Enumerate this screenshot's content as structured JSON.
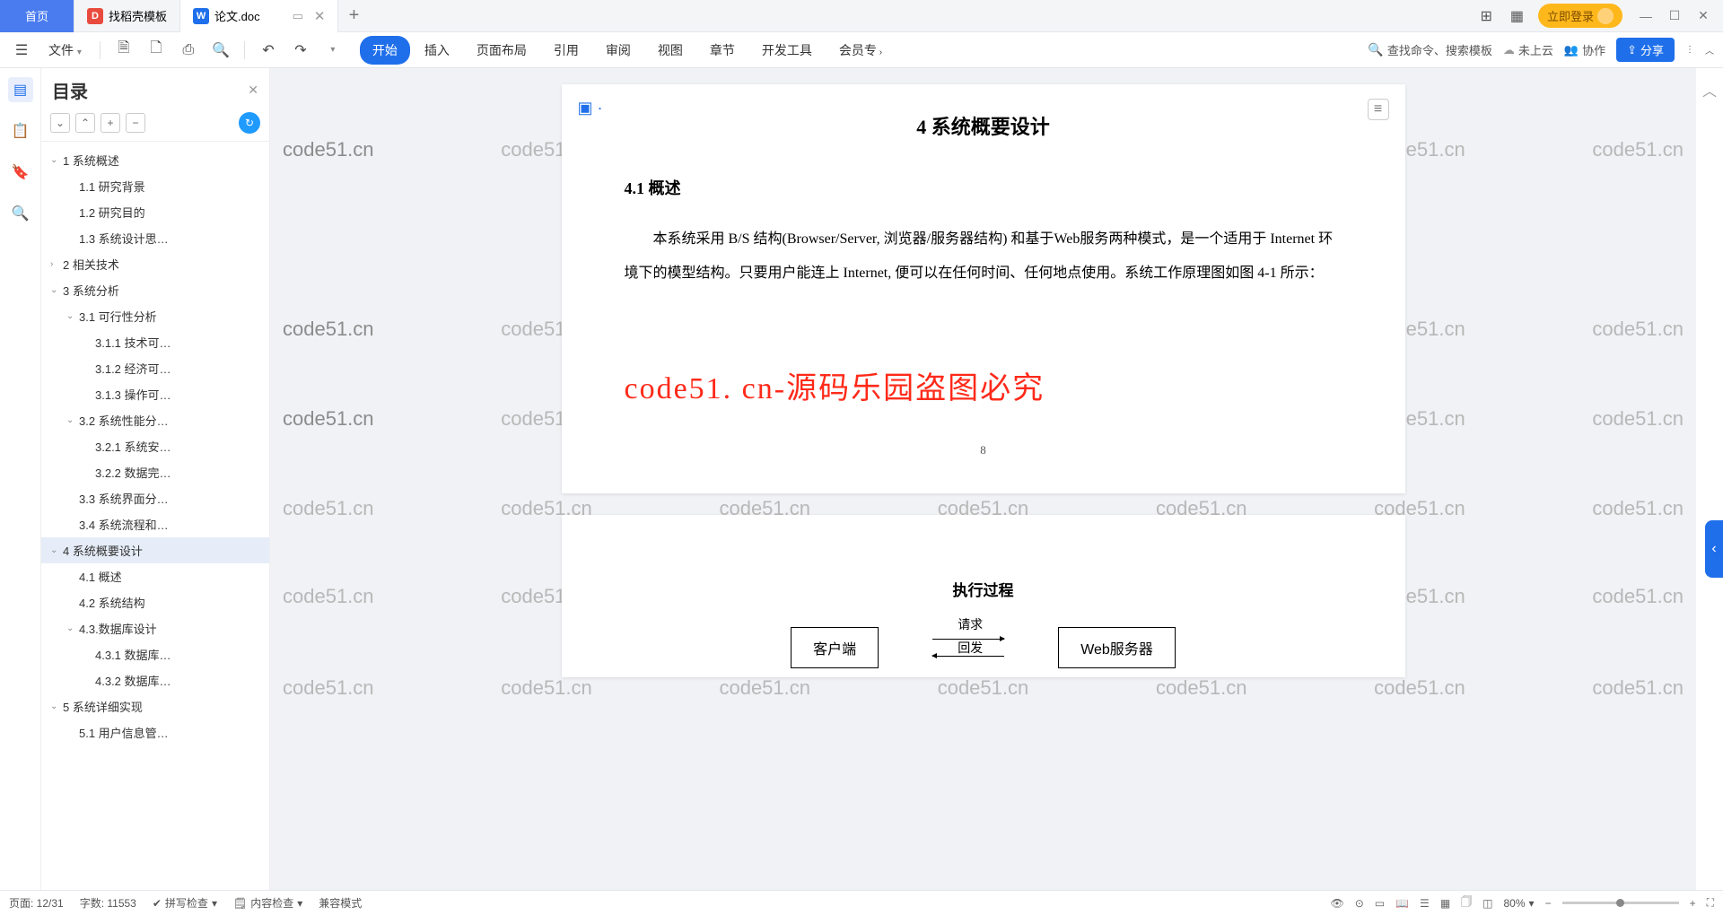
{
  "tabs": {
    "home": "首页",
    "t1": "找稻壳模板",
    "t2": "论文.doc",
    "add": "+"
  },
  "titlebar": {
    "login": "立即登录"
  },
  "qat": {
    "file": "文件"
  },
  "ribbon": {
    "tabs": [
      "开始",
      "插入",
      "页面布局",
      "引用",
      "审阅",
      "视图",
      "章节",
      "开发工具",
      "会员专"
    ],
    "search": "查找命令、搜索模板",
    "cloud": "未上云",
    "collab": "协作",
    "share": "分享"
  },
  "outline": {
    "title": "目录",
    "items": [
      {
        "lvl": 1,
        "caret": "v",
        "label": "1 系统概述",
        "active": false
      },
      {
        "lvl": 2,
        "caret": "",
        "label": "1.1 研究背景",
        "active": false
      },
      {
        "lvl": 2,
        "caret": "",
        "label": "1.2 研究目的",
        "active": false
      },
      {
        "lvl": 2,
        "caret": "",
        "label": "1.3 系统设计思…",
        "active": false
      },
      {
        "lvl": 1,
        "caret": ">",
        "label": "2 相关技术",
        "active": false
      },
      {
        "lvl": 1,
        "caret": "v",
        "label": "3 系统分析",
        "active": false
      },
      {
        "lvl": 2,
        "caret": "v",
        "label": "3.1 可行性分析",
        "active": false
      },
      {
        "lvl": 3,
        "caret": "",
        "label": "3.1.1 技术可…",
        "active": false
      },
      {
        "lvl": 3,
        "caret": "",
        "label": "3.1.2 经济可…",
        "active": false
      },
      {
        "lvl": 3,
        "caret": "",
        "label": "3.1.3 操作可…",
        "active": false
      },
      {
        "lvl": 2,
        "caret": "v",
        "label": "3.2 系统性能分…",
        "active": false
      },
      {
        "lvl": 3,
        "caret": "",
        "label": "3.2.1 系统安…",
        "active": false
      },
      {
        "lvl": 3,
        "caret": "",
        "label": "3.2.2 数据完…",
        "active": false
      },
      {
        "lvl": 2,
        "caret": "",
        "label": "3.3 系统界面分…",
        "active": false
      },
      {
        "lvl": 2,
        "caret": "",
        "label": "3.4 系统流程和…",
        "active": false
      },
      {
        "lvl": 1,
        "caret": "v",
        "label": "4 系统概要设计",
        "active": true
      },
      {
        "lvl": 2,
        "caret": "",
        "label": "4.1 概述",
        "active": false
      },
      {
        "lvl": 2,
        "caret": "",
        "label": "4.2 系统结构",
        "active": false
      },
      {
        "lvl": 2,
        "caret": "v",
        "label": "4.3.数据库设计",
        "active": false
      },
      {
        "lvl": 3,
        "caret": "",
        "label": "4.3.1 数据库…",
        "active": false
      },
      {
        "lvl": 3,
        "caret": "",
        "label": "4.3.2 数据库…",
        "active": false
      },
      {
        "lvl": 1,
        "caret": "v",
        "label": "5 系统详细实现",
        "active": false
      },
      {
        "lvl": 2,
        "caret": "",
        "label": "5.1 用户信息管…",
        "active": false
      }
    ]
  },
  "doc": {
    "h1": "4 系统概要设计",
    "h2": "4.1 概述",
    "p1": "本系统采用 B/S 结构(Browser/Server, 浏览器/服务器结构) 和基于Web服务两种模式，是一个适用于 Internet 环境下的模型结构。只要用户能连上 Internet, 便可以在任何时间、任何地点使用。系统工作原理图如图 4-1 所示：",
    "wm_big": "code51. cn-源码乐园盗图必究",
    "pnum": "8",
    "h3": "执行过程",
    "box_left": "客户端",
    "box_right": "Web服务器",
    "arr_req": "请求",
    "arr_res": "回发"
  },
  "statusbar": {
    "page": "页面: 12/31",
    "words": "字数: 11553",
    "spell": "拼写检查",
    "content": "内容检查",
    "compat": "兼容模式",
    "zoom": "80%"
  },
  "watermark": "code51.cn"
}
